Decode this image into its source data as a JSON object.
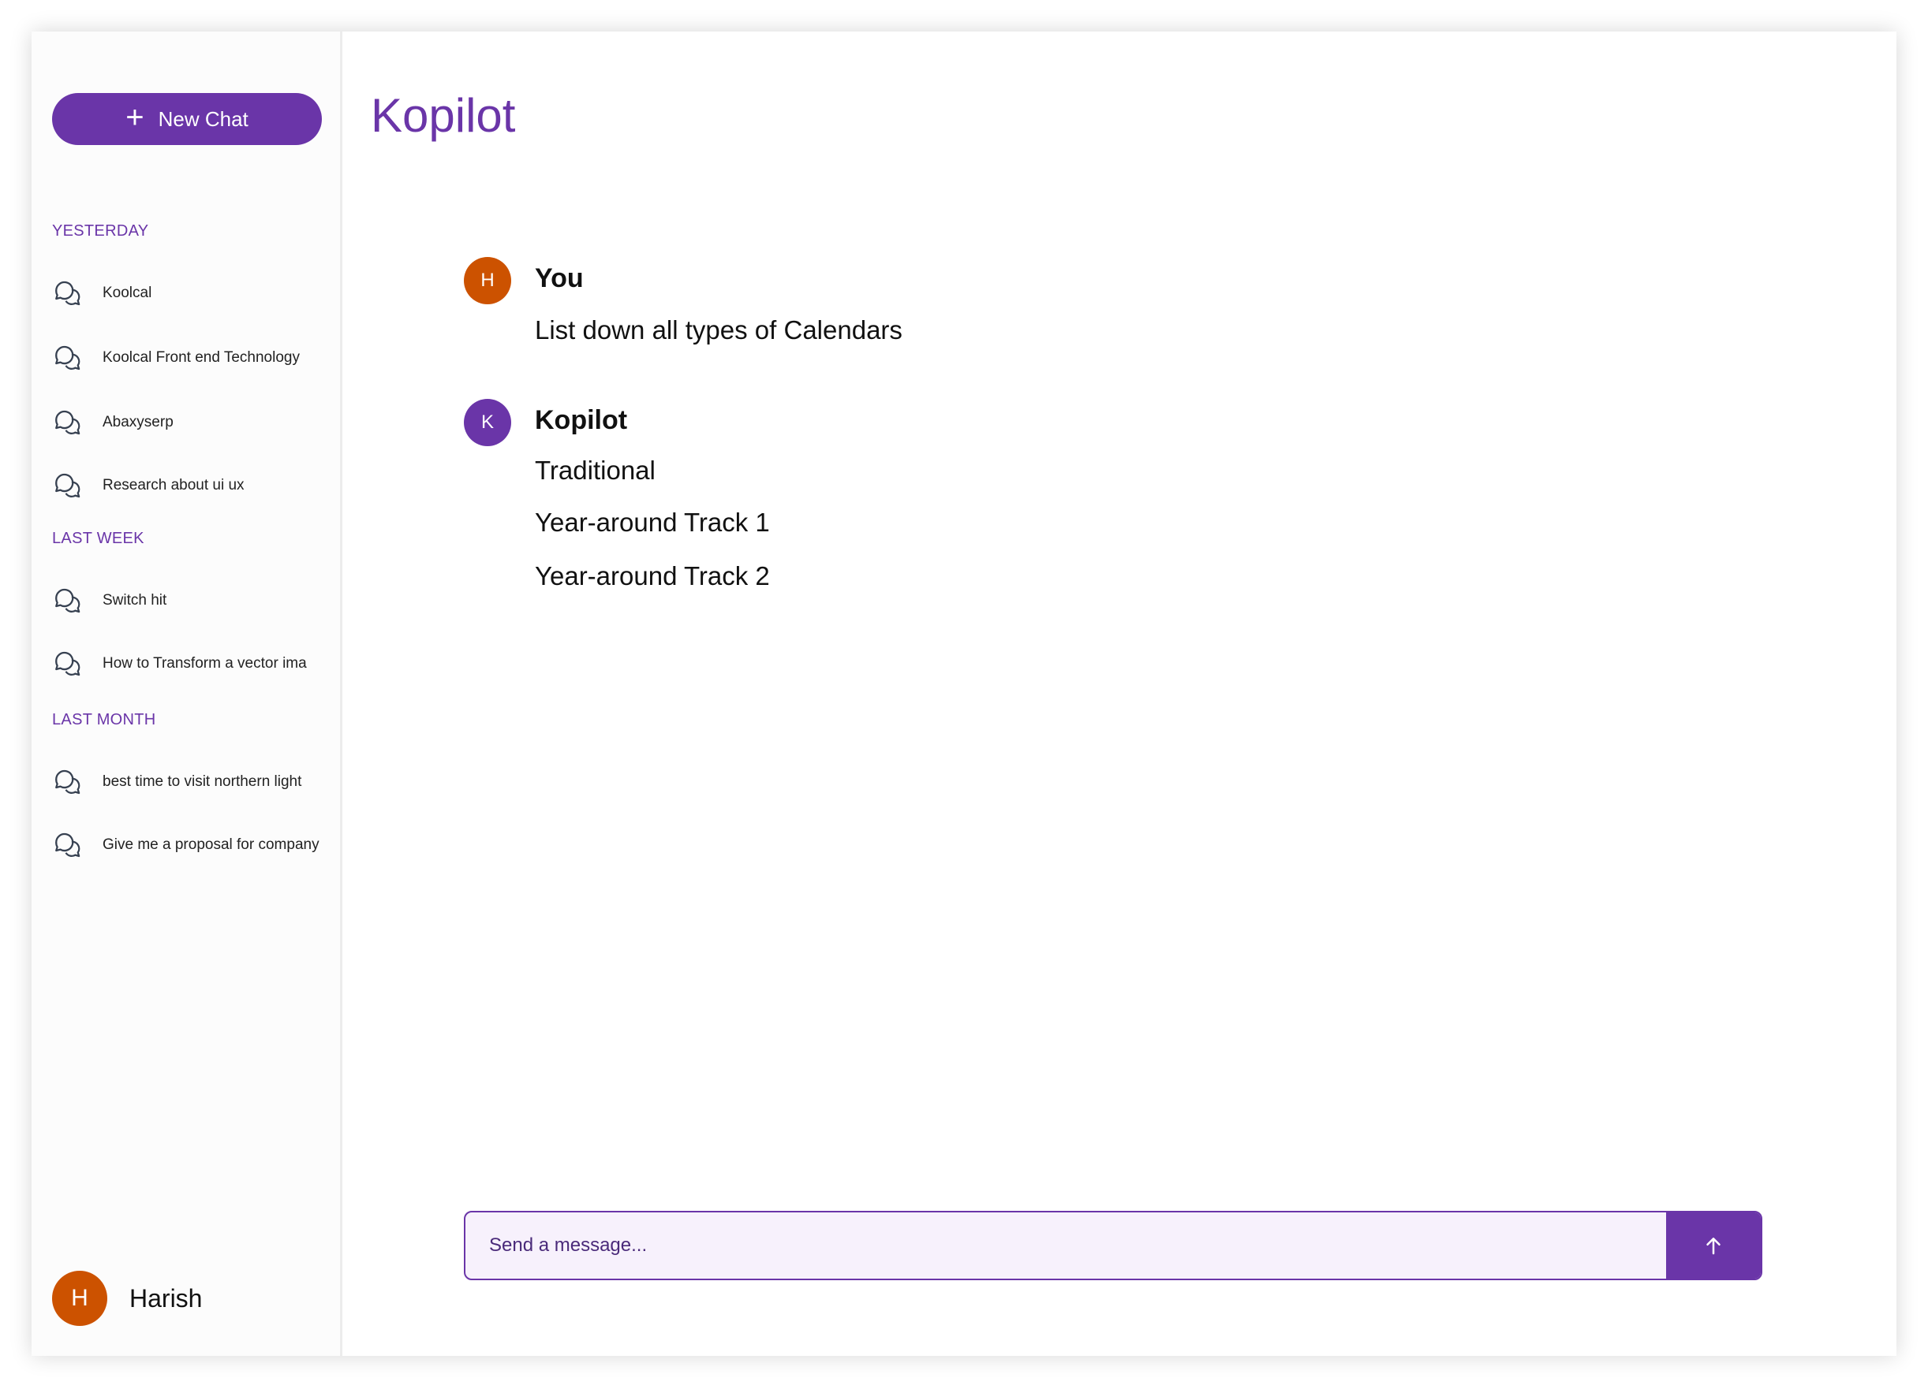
{
  "sidebar": {
    "new_chat_label": "New Chat",
    "sections": [
      {
        "title": "YESTERDAY",
        "items": [
          "Koolcal",
          "Koolcal Front end Technology",
          "Abaxyserp",
          "Research about ui ux"
        ]
      },
      {
        "title": "LAST WEEK",
        "items": [
          "Switch hit",
          "How to Transform a vector ima"
        ]
      },
      {
        "title": "LAST MONTH",
        "items": [
          "best time to visit northern light",
          "Give me a proposal for company"
        ]
      }
    ],
    "user": {
      "initial": "H",
      "name": "Harish"
    }
  },
  "main": {
    "title": "Kopilot",
    "messages": [
      {
        "initial": "H",
        "author": "You",
        "lines": [
          "List down all types of Calendars"
        ]
      },
      {
        "initial": "K",
        "author": "Kopilot",
        "lines": [
          "Traditional",
          "Year-around Track 1",
          "Year-around Track 2"
        ]
      }
    ],
    "composer": {
      "placeholder": "Send a message..."
    }
  },
  "colors": {
    "accent": "#6a35a8",
    "user_avatar": "#cc5200",
    "composer_bg": "#f7f1fc"
  },
  "icons": {
    "new_chat": "plus-icon",
    "chat_item": "chat-bubbles-icon",
    "send": "arrow-up-icon"
  }
}
